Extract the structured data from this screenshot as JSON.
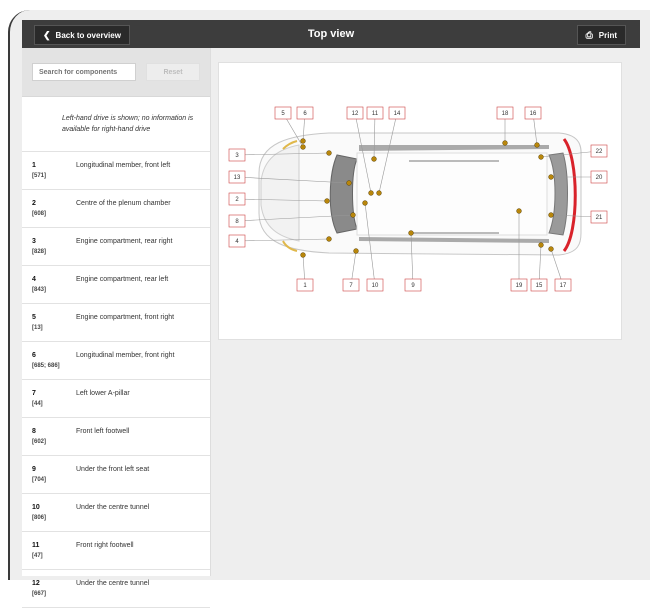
{
  "header": {
    "back_label": "Back to overview",
    "title": "Top view",
    "print_label": "Print"
  },
  "search": {
    "placeholder": "Search for components",
    "button_label": "Reset"
  },
  "sidebar": {
    "note": "Left-hand drive is shown; no information is available for right-hand drive",
    "items": [
      {
        "num": "1",
        "ref": "[571]",
        "label": "Longitudinal member, front left"
      },
      {
        "num": "2",
        "ref": "[608]",
        "label": "Centre of the plenum chamber"
      },
      {
        "num": "3",
        "ref": "[828]",
        "label": "Engine compartment, rear right"
      },
      {
        "num": "4",
        "ref": "[843]",
        "label": "Engine compartment, rear left"
      },
      {
        "num": "5",
        "ref": "[13]",
        "label": "Engine compartment, front right"
      },
      {
        "num": "6",
        "ref": "[685; 686]",
        "label": "Longitudinal member, front right"
      },
      {
        "num": "7",
        "ref": "[44]",
        "label": "Left lower A-pillar"
      },
      {
        "num": "8",
        "ref": "[602]",
        "label": "Front left footwell"
      },
      {
        "num": "9",
        "ref": "[704]",
        "label": "Under the front left seat"
      },
      {
        "num": "10",
        "ref": "[806]",
        "label": "Under the centre tunnel"
      },
      {
        "num": "11",
        "ref": "[47]",
        "label": "Front right footwell"
      },
      {
        "num": "12",
        "ref": "[667]",
        "label": "Under the centre tunnel"
      }
    ]
  },
  "diagram": {
    "callouts": [
      "1",
      "2",
      "3",
      "4",
      "5",
      "6",
      "7",
      "8",
      "9",
      "10",
      "11",
      "12",
      "13",
      "14",
      "15",
      "16",
      "17",
      "18",
      "19",
      "20",
      "21",
      "22"
    ],
    "accent_color": "#d9222a",
    "marker_color": "#b8860b"
  }
}
